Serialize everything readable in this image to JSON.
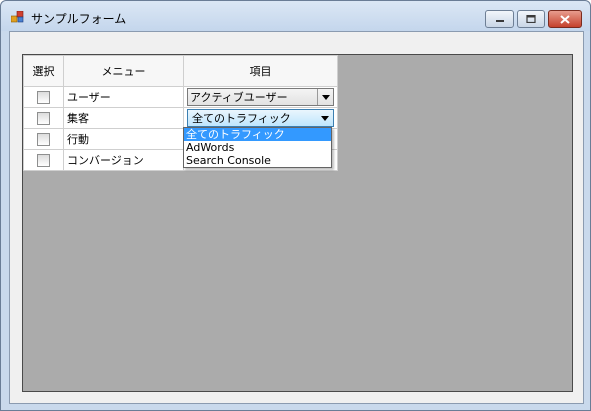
{
  "window": {
    "title": "サンプルフォーム"
  },
  "grid": {
    "headers": {
      "select": "選択",
      "menu": "メニュー",
      "item": "項目"
    },
    "rows": [
      {
        "checked": false,
        "menu": "ユーザー",
        "item": "アクティブユーザー"
      },
      {
        "checked": false,
        "menu": "集客",
        "item": "全てのトラフィック"
      },
      {
        "checked": false,
        "menu": "行動",
        "item": ""
      },
      {
        "checked": false,
        "menu": "コンバージョン",
        "item": ""
      }
    ]
  },
  "dropdown": {
    "options": [
      "全てのトラフィック",
      "AdWords",
      "Search Console"
    ],
    "selected_index": 0
  },
  "colors": {
    "selection": "#3399ff",
    "panel_background": "#ababab",
    "close_button": "#c5412c"
  },
  "icons": {
    "app": "app-icon",
    "minimize": "minimize-icon",
    "maximize": "maximize-icon",
    "close": "close-icon",
    "combo_arrow": "chevron-down-icon"
  }
}
